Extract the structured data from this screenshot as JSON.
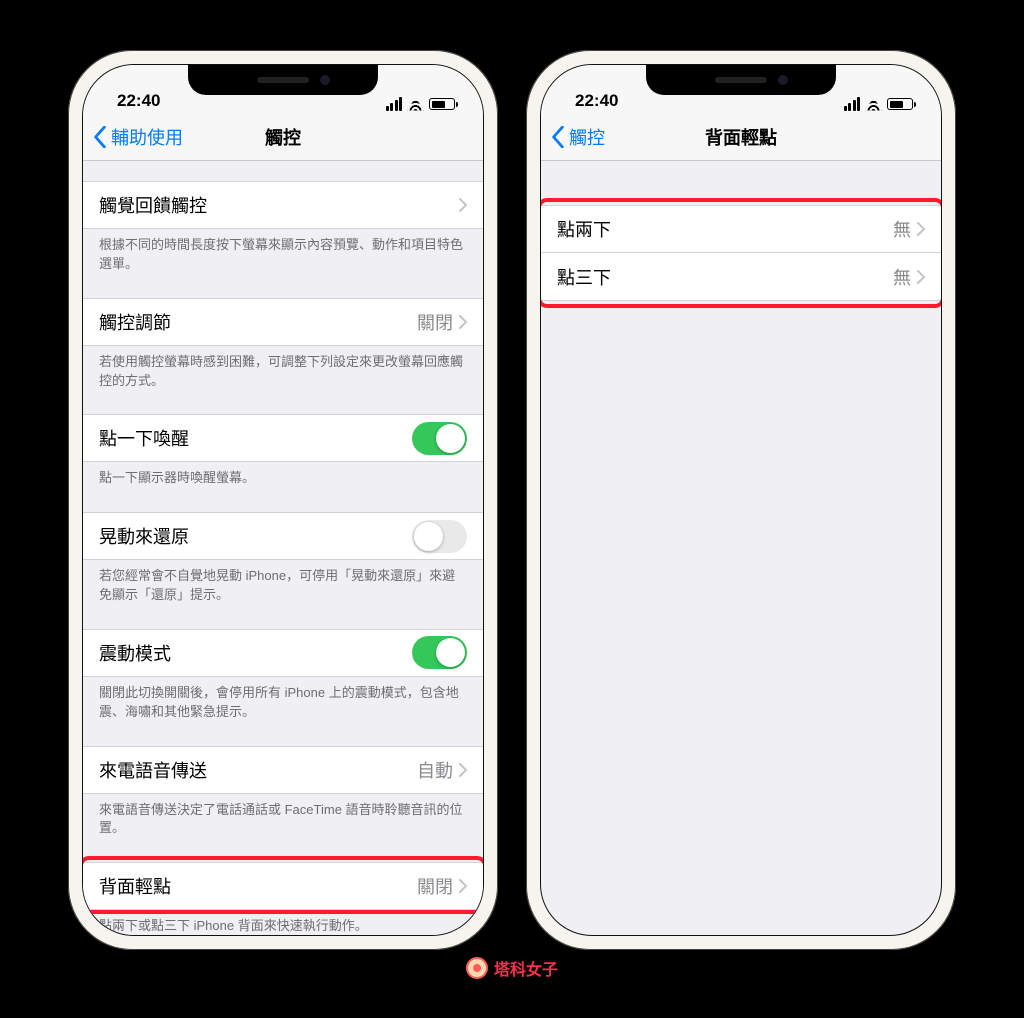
{
  "status": {
    "time": "22:40"
  },
  "left": {
    "back": "輔助使用",
    "title": "觸控",
    "rows": {
      "haptic": {
        "label": "觸覺回饋觸控",
        "footer": "根據不同的時間長度按下螢幕來顯示內容預覽、動作和項目特色選單。"
      },
      "accommodation": {
        "label": "觸控調節",
        "value": "關閉",
        "footer": "若使用觸控螢幕時感到困難，可調整下列設定來更改螢幕回應觸控的方式。"
      },
      "tapToWake": {
        "label": "點一下喚醒",
        "on": true,
        "footer": "點一下顯示器時喚醒螢幕。"
      },
      "shakeUndo": {
        "label": "晃動來還原",
        "on": false,
        "footer": "若您經常會不自覺地晃動 iPhone，可停用「晃動來還原」來避免顯示「還原」提示。"
      },
      "vibration": {
        "label": "震動模式",
        "on": true,
        "footer": "關閉此切換開關後，會停用所有 iPhone 上的震動模式，包含地震、海嘯和其他緊急提示。"
      },
      "callAudio": {
        "label": "來電語音傳送",
        "value": "自動",
        "footer": "來電語音傳送決定了電話通話或 FaceTime 語音時聆聽音訊的位置。"
      },
      "backTap": {
        "label": "背面輕點",
        "value": "關閉",
        "footer": "點兩下或點三下 iPhone 背面來快速執行動作。"
      }
    }
  },
  "right": {
    "back": "觸控",
    "title": "背面輕點",
    "rows": {
      "double": {
        "label": "點兩下",
        "value": "無"
      },
      "triple": {
        "label": "點三下",
        "value": "無"
      }
    }
  },
  "watermark": "塔科女子"
}
